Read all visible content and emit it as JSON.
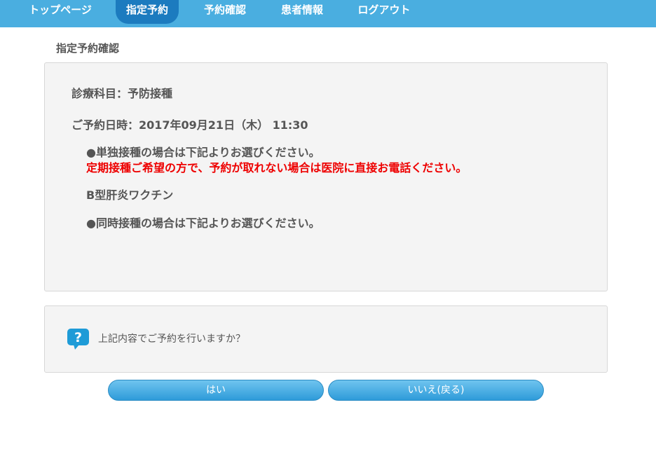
{
  "nav": {
    "items": [
      {
        "label": "トップページ"
      },
      {
        "label": "指定予約"
      },
      {
        "label": "予約確認"
      },
      {
        "label": "患者情報"
      },
      {
        "label": "ログアウト"
      }
    ]
  },
  "page": {
    "title": "指定予約確認"
  },
  "details": {
    "department": "診療科目：予防接種",
    "datetime": "ご予約日時：2017年09月21日（木） 11:30",
    "single_note": "●単独接種の場合は下記よりお選びください。",
    "warning": "定期接種ご希望の方で、予約が取れない場合は医院に直接お電話ください。",
    "vaccine": "B型肝炎ワクチン",
    "simultaneous_note": "●同時接種の場合は下記よりお選びください。"
  },
  "confirm": {
    "question": "上記内容でご予約を行いますか？",
    "icon": "question-bubble-icon"
  },
  "buttons": {
    "yes": "はい",
    "no": "いいえ(戻る)"
  },
  "colors": {
    "nav_bg": "#4aaee0",
    "nav_active": "#1c7bbf",
    "warning": "#ee0000",
    "button": "#2e9bd9"
  }
}
